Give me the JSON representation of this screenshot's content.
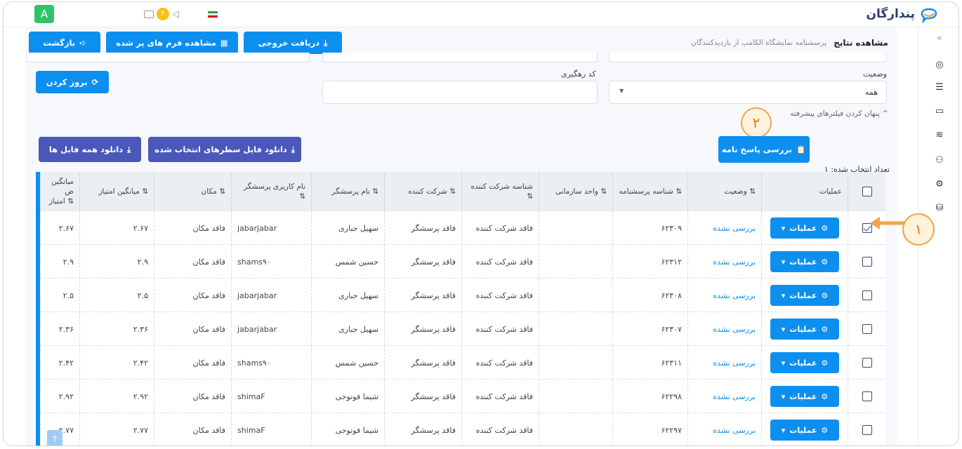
{
  "app": {
    "logo_text": "پندارگان",
    "user_initial": "A",
    "notification_count": "۲"
  },
  "header": {
    "title": "مشاهده نتایج",
    "subtitle": "پرسشنامه نمایشگاه الکامپ از بازدیدکنندگان",
    "back_label": "بازگشت",
    "view_forms_label": "مشاهده فرم های پر شده",
    "export_label": "دریافت خروجی"
  },
  "filters": {
    "status_label": "وضعیت",
    "status_value": "همه",
    "tracking_label": "کد رهگیری",
    "tracking_value": "",
    "refresh_label": "بروز کردن",
    "advanced_toggle": "پنهان کردن فیلترهای پیشرفته"
  },
  "actions": {
    "selected_count_label": "تعداد انتخاب شده:",
    "selected_count": "۱",
    "review_label": "بررسی پاسخ نامه",
    "download_selected_label": "دانلود فایل سطرهای انتخاب شده",
    "download_all_label": "دانلود همه فایل ها"
  },
  "annotations": {
    "marker_1": "۱",
    "marker_2": "۲"
  },
  "table": {
    "columns": {
      "operations": "عملیات",
      "status": "وضعیت ⇅",
      "questionnaire_id": "شناسه پرسشنامه ⇅",
      "org_unit": "واحد سازمانی ⇅",
      "participant_company_id": "شناسه شرکت کننده ⇅",
      "participant_company": "شرکت کننده ⇅",
      "questioner_name": "نام پرسشگر ⇅",
      "questioner_username": "نام کاربری پرسشگر ⇅",
      "location": "مکان ⇅",
      "avg_score": "میانگین امتیاز ⇅",
      "avg_weighted": "میانگین ض امتیاز ⇅"
    },
    "op_button_label": "عملیات",
    "rows": [
      {
        "checked": true,
        "status": "بررسی نشده",
        "qid": "۶۲۳۰۹",
        "org": "",
        "pcid": "فاقد شرکت کننده",
        "pc": "فاقد پرسشگر",
        "name": "سهیل جباری",
        "user": "jabarjabar",
        "loc": "فاقد مکان",
        "avg": "۲.۶۷",
        "avgw": "۲.۶۷"
      },
      {
        "checked": false,
        "status": "بررسی نشده",
        "qid": "۶۲۳۱۲",
        "org": "",
        "pcid": "فاقد شرکت کننده",
        "pc": "فاقد پرسشگر",
        "name": "حسین شمس",
        "user": "shams۹۰",
        "loc": "فاقد مکان",
        "avg": "۲.۹",
        "avgw": "۲.۹"
      },
      {
        "checked": false,
        "status": "بررسی نشده",
        "qid": "۶۲۳۰۸",
        "org": "",
        "pcid": "فاقد شرکت کننده",
        "pc": "فاقد پرسشگر",
        "name": "سهیل جباری",
        "user": "jabarjabar",
        "loc": "فاقد مکان",
        "avg": "۲.۵",
        "avgw": "۲.۵"
      },
      {
        "checked": false,
        "status": "بررسی نشده",
        "qid": "۶۲۳۰۷",
        "org": "",
        "pcid": "فاقد شرکت کننده",
        "pc": "فاقد پرسشگر",
        "name": "سهیل جباری",
        "user": "jabarjabar",
        "loc": "فاقد مکان",
        "avg": "۲.۳۶",
        "avgw": "۲.۳۶"
      },
      {
        "checked": false,
        "status": "بررسی نشده",
        "qid": "۶۲۳۱۱",
        "org": "",
        "pcid": "فاقد شرکت کننده",
        "pc": "فاقد پرسشگر",
        "name": "حسین شمس",
        "user": "shams۹۰",
        "loc": "فاقد مکان",
        "avg": "۲.۴۲",
        "avgw": "۲.۴۲"
      },
      {
        "checked": false,
        "status": "بررسی نشده",
        "qid": "۶۲۲۹۸",
        "org": "",
        "pcid": "فاقد شرکت کننده",
        "pc": "فاقد پرسشگر",
        "name": "شیما فوتوحی",
        "user": "shimaF",
        "loc": "فاقد مکان",
        "avg": "۲.۹۲",
        "avgw": "۲.۹۲"
      },
      {
        "checked": false,
        "status": "بررسی نشده",
        "qid": "۶۲۲۹۷",
        "org": "",
        "pcid": "فاقد شرکت کننده",
        "pc": "فاقد پرسشگر",
        "name": "شیما فوتوحی",
        "user": "shimaF",
        "loc": "فاقد مکان",
        "avg": "۲.۷۷",
        "avgw": "۲.۷۷"
      }
    ]
  },
  "colors": {
    "accent": "#0d8ff0",
    "indigo": "#4958b9",
    "marker": "#f0a44b"
  }
}
